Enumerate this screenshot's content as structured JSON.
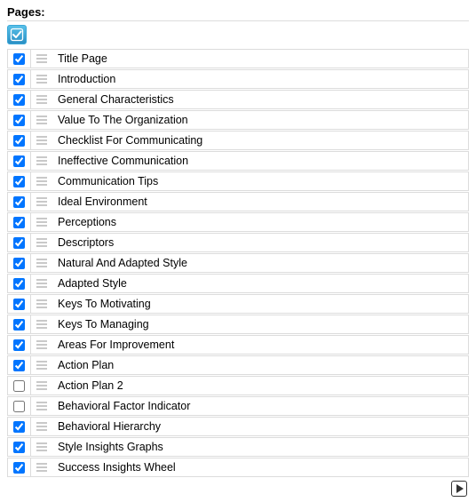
{
  "header": "Pages:",
  "rows": [
    {
      "checked": true,
      "label": "Title Page"
    },
    {
      "checked": true,
      "label": "Introduction"
    },
    {
      "checked": true,
      "label": "General Characteristics"
    },
    {
      "checked": true,
      "label": "Value To The Organization"
    },
    {
      "checked": true,
      "label": "Checklist For Communicating"
    },
    {
      "checked": true,
      "label": "Ineffective Communication"
    },
    {
      "checked": true,
      "label": "Communication Tips"
    },
    {
      "checked": true,
      "label": "Ideal Environment"
    },
    {
      "checked": true,
      "label": "Perceptions"
    },
    {
      "checked": true,
      "label": "Descriptors"
    },
    {
      "checked": true,
      "label": "Natural And Adapted Style"
    },
    {
      "checked": true,
      "label": "Adapted Style"
    },
    {
      "checked": true,
      "label": "Keys To Motivating"
    },
    {
      "checked": true,
      "label": "Keys To Managing"
    },
    {
      "checked": true,
      "label": "Areas For Improvement"
    },
    {
      "checked": true,
      "label": "Action Plan"
    },
    {
      "checked": false,
      "label": "Action Plan 2"
    },
    {
      "checked": false,
      "label": "Behavioral Factor Indicator"
    },
    {
      "checked": true,
      "label": "Behavioral Hierarchy"
    },
    {
      "checked": true,
      "label": "Style Insights Graphs"
    },
    {
      "checked": true,
      "label": "Success Insights Wheel"
    }
  ]
}
